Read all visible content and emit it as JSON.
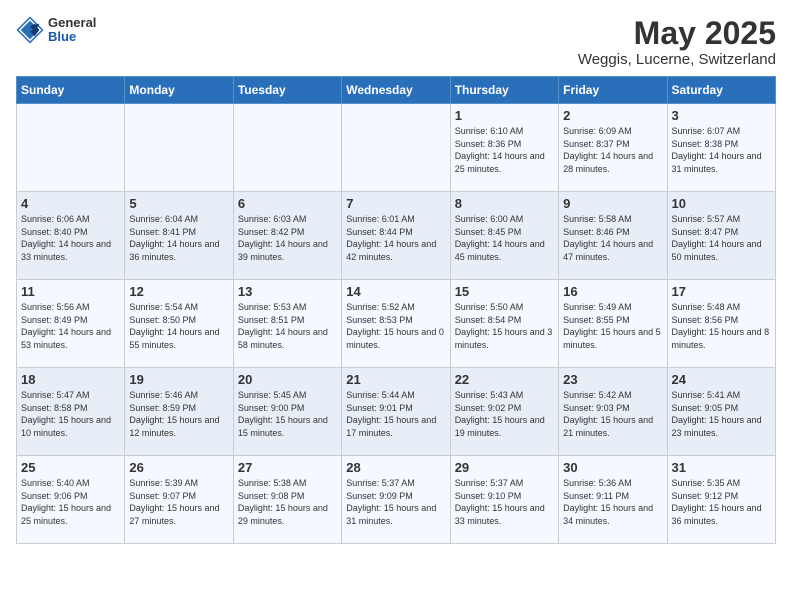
{
  "header": {
    "logo": {
      "general": "General",
      "blue": "Blue"
    },
    "title": "May 2025",
    "location": "Weggis, Lucerne, Switzerland"
  },
  "weekdays": [
    "Sunday",
    "Monday",
    "Tuesday",
    "Wednesday",
    "Thursday",
    "Friday",
    "Saturday"
  ],
  "weeks": [
    [
      {
        "day": "",
        "info": ""
      },
      {
        "day": "",
        "info": ""
      },
      {
        "day": "",
        "info": ""
      },
      {
        "day": "",
        "info": ""
      },
      {
        "day": "1",
        "info": "Sunrise: 6:10 AM\nSunset: 8:36 PM\nDaylight: 14 hours\nand 25 minutes."
      },
      {
        "day": "2",
        "info": "Sunrise: 6:09 AM\nSunset: 8:37 PM\nDaylight: 14 hours\nand 28 minutes."
      },
      {
        "day": "3",
        "info": "Sunrise: 6:07 AM\nSunset: 8:38 PM\nDaylight: 14 hours\nand 31 minutes."
      }
    ],
    [
      {
        "day": "4",
        "info": "Sunrise: 6:06 AM\nSunset: 8:40 PM\nDaylight: 14 hours\nand 33 minutes."
      },
      {
        "day": "5",
        "info": "Sunrise: 6:04 AM\nSunset: 8:41 PM\nDaylight: 14 hours\nand 36 minutes."
      },
      {
        "day": "6",
        "info": "Sunrise: 6:03 AM\nSunset: 8:42 PM\nDaylight: 14 hours\nand 39 minutes."
      },
      {
        "day": "7",
        "info": "Sunrise: 6:01 AM\nSunset: 8:44 PM\nDaylight: 14 hours\nand 42 minutes."
      },
      {
        "day": "8",
        "info": "Sunrise: 6:00 AM\nSunset: 8:45 PM\nDaylight: 14 hours\nand 45 minutes."
      },
      {
        "day": "9",
        "info": "Sunrise: 5:58 AM\nSunset: 8:46 PM\nDaylight: 14 hours\nand 47 minutes."
      },
      {
        "day": "10",
        "info": "Sunrise: 5:57 AM\nSunset: 8:47 PM\nDaylight: 14 hours\nand 50 minutes."
      }
    ],
    [
      {
        "day": "11",
        "info": "Sunrise: 5:56 AM\nSunset: 8:49 PM\nDaylight: 14 hours\nand 53 minutes."
      },
      {
        "day": "12",
        "info": "Sunrise: 5:54 AM\nSunset: 8:50 PM\nDaylight: 14 hours\nand 55 minutes."
      },
      {
        "day": "13",
        "info": "Sunrise: 5:53 AM\nSunset: 8:51 PM\nDaylight: 14 hours\nand 58 minutes."
      },
      {
        "day": "14",
        "info": "Sunrise: 5:52 AM\nSunset: 8:53 PM\nDaylight: 15 hours\nand 0 minutes."
      },
      {
        "day": "15",
        "info": "Sunrise: 5:50 AM\nSunset: 8:54 PM\nDaylight: 15 hours\nand 3 minutes."
      },
      {
        "day": "16",
        "info": "Sunrise: 5:49 AM\nSunset: 8:55 PM\nDaylight: 15 hours\nand 5 minutes."
      },
      {
        "day": "17",
        "info": "Sunrise: 5:48 AM\nSunset: 8:56 PM\nDaylight: 15 hours\nand 8 minutes."
      }
    ],
    [
      {
        "day": "18",
        "info": "Sunrise: 5:47 AM\nSunset: 8:58 PM\nDaylight: 15 hours\nand 10 minutes."
      },
      {
        "day": "19",
        "info": "Sunrise: 5:46 AM\nSunset: 8:59 PM\nDaylight: 15 hours\nand 12 minutes."
      },
      {
        "day": "20",
        "info": "Sunrise: 5:45 AM\nSunset: 9:00 PM\nDaylight: 15 hours\nand 15 minutes."
      },
      {
        "day": "21",
        "info": "Sunrise: 5:44 AM\nSunset: 9:01 PM\nDaylight: 15 hours\nand 17 minutes."
      },
      {
        "day": "22",
        "info": "Sunrise: 5:43 AM\nSunset: 9:02 PM\nDaylight: 15 hours\nand 19 minutes."
      },
      {
        "day": "23",
        "info": "Sunrise: 5:42 AM\nSunset: 9:03 PM\nDaylight: 15 hours\nand 21 minutes."
      },
      {
        "day": "24",
        "info": "Sunrise: 5:41 AM\nSunset: 9:05 PM\nDaylight: 15 hours\nand 23 minutes."
      }
    ],
    [
      {
        "day": "25",
        "info": "Sunrise: 5:40 AM\nSunset: 9:06 PM\nDaylight: 15 hours\nand 25 minutes."
      },
      {
        "day": "26",
        "info": "Sunrise: 5:39 AM\nSunset: 9:07 PM\nDaylight: 15 hours\nand 27 minutes."
      },
      {
        "day": "27",
        "info": "Sunrise: 5:38 AM\nSunset: 9:08 PM\nDaylight: 15 hours\nand 29 minutes."
      },
      {
        "day": "28",
        "info": "Sunrise: 5:37 AM\nSunset: 9:09 PM\nDaylight: 15 hours\nand 31 minutes."
      },
      {
        "day": "29",
        "info": "Sunrise: 5:37 AM\nSunset: 9:10 PM\nDaylight: 15 hours\nand 33 minutes."
      },
      {
        "day": "30",
        "info": "Sunrise: 5:36 AM\nSunset: 9:11 PM\nDaylight: 15 hours\nand 34 minutes."
      },
      {
        "day": "31",
        "info": "Sunrise: 5:35 AM\nSunset: 9:12 PM\nDaylight: 15 hours\nand 36 minutes."
      }
    ]
  ]
}
